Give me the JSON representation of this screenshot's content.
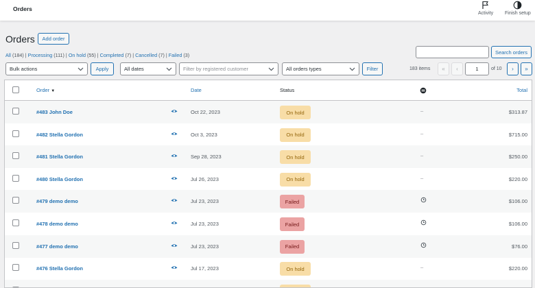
{
  "topbar": {
    "title": "Orders",
    "activity_label": "Activity",
    "finish_label": "Finish setup"
  },
  "page": {
    "heading": "Orders",
    "add_order_label": "Add order"
  },
  "filters": [
    {
      "label": "All",
      "count": "(184)"
    },
    {
      "label": "Processing",
      "count": "(111)"
    },
    {
      "label": "On hold",
      "count": "(55)"
    },
    {
      "label": "Completed",
      "count": "(7)"
    },
    {
      "label": "Cancelled",
      "count": "(7)"
    },
    {
      "label": "Failed",
      "count": "(3)"
    }
  ],
  "search": {
    "button_label": "Search orders",
    "value": ""
  },
  "toolbar": {
    "bulk_actions": "Bulk actions",
    "apply_label": "Apply",
    "dates": "All dates",
    "customer_placeholder": "Filter by registered customer",
    "orders_types": "All orders types",
    "filter_label": "Filter"
  },
  "pagination": {
    "items": "183 items",
    "first": "«",
    "prev": "‹",
    "next": "›",
    "last": "»",
    "current_page": "1",
    "of_pages": "of 10"
  },
  "columns": {
    "order": "Order",
    "date": "Date",
    "status": "Status",
    "total": "Total"
  },
  "colors": {
    "on_hold_bg": "#f8dda7",
    "on_hold_fg": "#94660c",
    "failed_bg": "#eba3a3",
    "failed_fg": "#761919",
    "accent": "#2271b1"
  },
  "rows": [
    {
      "order": "#483 John Doe",
      "date": "Oct 22, 2023",
      "status": "On hold",
      "status_type": "on-hold",
      "origin": "–",
      "origin_type": "dash",
      "total": "$313.87"
    },
    {
      "order": "#482 Stella Gordon",
      "date": "Oct 3, 2023",
      "status": "On hold",
      "status_type": "on-hold",
      "origin": "–",
      "origin_type": "dash",
      "total": "$715.00"
    },
    {
      "order": "#481 Stella Gordon",
      "date": "Sep 28, 2023",
      "status": "On hold",
      "status_type": "on-hold",
      "origin": "–",
      "origin_type": "dash",
      "total": "$250.00"
    },
    {
      "order": "#480 Stella Gordon",
      "date": "Jul 26, 2023",
      "status": "On hold",
      "status_type": "on-hold",
      "origin": "–",
      "origin_type": "dash",
      "total": "$220.00"
    },
    {
      "order": "#479 demo demo",
      "date": "Jul 23, 2023",
      "status": "Failed",
      "status_type": "failed",
      "origin": "history-icon",
      "origin_type": "icon",
      "total": "$106.00"
    },
    {
      "order": "#478 demo demo",
      "date": "Jul 23, 2023",
      "status": "Failed",
      "status_type": "failed",
      "origin": "history-icon",
      "origin_type": "icon",
      "total": "$106.00"
    },
    {
      "order": "#477 demo demo",
      "date": "Jul 23, 2023",
      "status": "Failed",
      "status_type": "failed",
      "origin": "history-icon",
      "origin_type": "icon",
      "total": "$76.00"
    },
    {
      "order": "#476 Stella Gordon",
      "date": "Jul 17, 2023",
      "status": "On hold",
      "status_type": "on-hold",
      "origin": "–",
      "origin_type": "dash",
      "total": "$220.00"
    },
    {
      "order": "",
      "date": "",
      "status": "",
      "status_type": "on-hold",
      "origin": "",
      "origin_type": "dash",
      "total": ""
    }
  ]
}
